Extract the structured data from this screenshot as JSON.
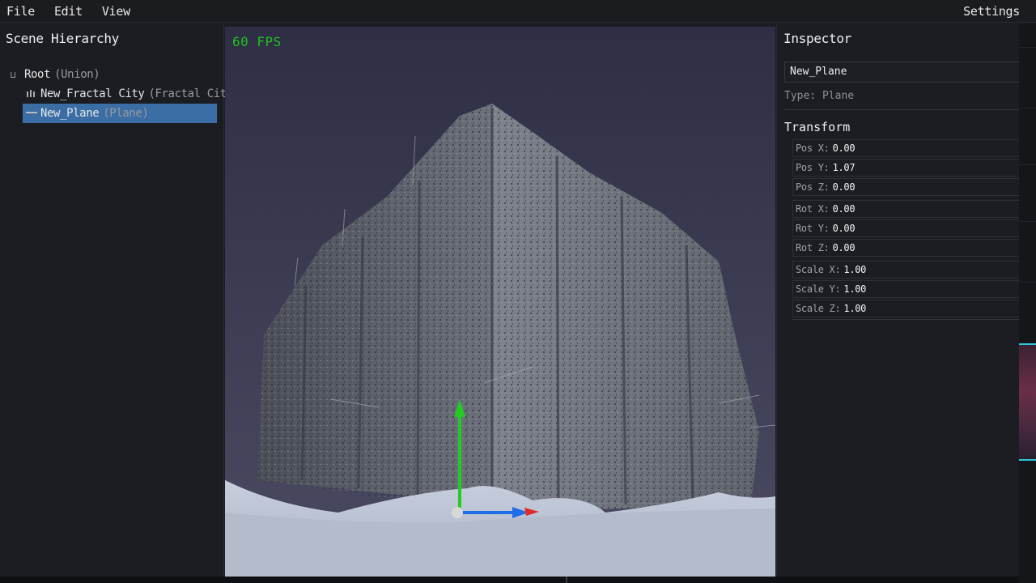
{
  "menu": {
    "file": "File",
    "edit": "Edit",
    "view": "View",
    "settings": "Settings"
  },
  "hierarchy": {
    "title": "Scene Hierarchy",
    "root": {
      "name": "Root",
      "kind": "(Union)"
    },
    "children": [
      {
        "name": "New_Fractal City",
        "kind": "(Fractal City)"
      },
      {
        "name": "New_Plane",
        "kind": "(Plane)",
        "selected": true
      }
    ]
  },
  "viewport": {
    "fps": "60 FPS",
    "colors": {
      "sky": "#343349",
      "ground": "#b9c0cf",
      "gizmo_y": "#22cc22",
      "gizmo_x": "#1e6fe6",
      "gizmo_z": "#e02a2a"
    }
  },
  "inspector": {
    "title": "Inspector",
    "name_value": "New_Plane",
    "type_line": "Type: Plane",
    "transform_title": "Transform",
    "position": [
      {
        "label": "Pos X:",
        "value": "0.00"
      },
      {
        "label": "Pos Y:",
        "value": "1.07"
      },
      {
        "label": "Pos Z:",
        "value": "0.00"
      }
    ],
    "rotation": [
      {
        "label": "Rot X:",
        "value": "0.00"
      },
      {
        "label": "Rot Y:",
        "value": "0.00"
      },
      {
        "label": "Rot Z:",
        "value": "0.00"
      }
    ],
    "scale": [
      {
        "label": "Scale X:",
        "value": "1.00"
      },
      {
        "label": "Scale Y:",
        "value": "1.00"
      },
      {
        "label": "Scale Z:",
        "value": "1.00"
      }
    ]
  },
  "accent_color": "#3a6ea5"
}
